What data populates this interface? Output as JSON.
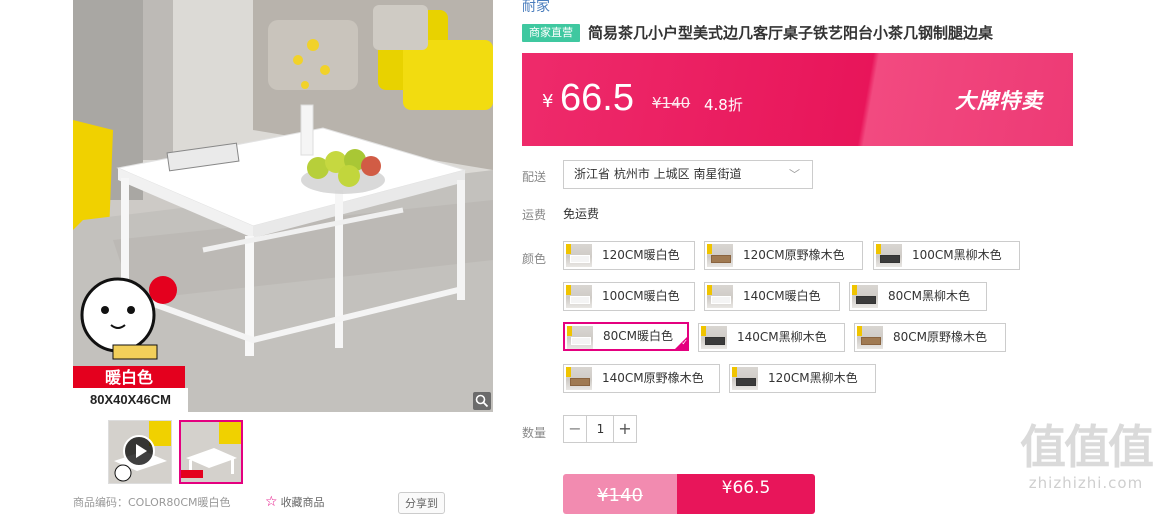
{
  "gallery": {
    "color_badge": "暖白色",
    "size_label": "80X40X46CM",
    "code_line": "商品编码：COLOR80CM暖白色",
    "favorite_label": "收藏商品",
    "share_label": "分享到"
  },
  "product": {
    "brand": "耐家",
    "tag": "商家直营",
    "title": "简易茶几小户型美式边几客厅桌子铁艺阳台小茶几钢制腿边桌"
  },
  "price": {
    "currency": "¥",
    "current": "66.5",
    "original": "¥140",
    "discount": "4.8折",
    "promo": "大牌特卖",
    "colors": {
      "banner": "#e8155a",
      "accent": "#e4007f",
      "tag": "#3fc8a0"
    }
  },
  "delivery": {
    "label": "配送",
    "address": "浙江省 杭州市 上城区 南星街道"
  },
  "shipping": {
    "label": "运费",
    "value": "免运费"
  },
  "color": {
    "label": "颜色",
    "options": [
      "120CM暖白色",
      "120CM原野橡木色",
      "100CM黑柳木色",
      "100CM暖白色",
      "140CM暖白色",
      "80CM黑柳木色",
      "80CM暖白色",
      "140CM黑柳木色",
      "80CM原野橡木色",
      "140CM原野橡木色",
      "120CM黑柳木色"
    ],
    "selected": "80CM暖白色"
  },
  "quantity": {
    "label": "数量",
    "value": "1",
    "minus": "−",
    "plus": "+"
  },
  "buy": {
    "original_price": "¥140",
    "sale_price": "¥66.5"
  },
  "watermark": {
    "big": "值值值",
    "small": "zhizhizhi.com"
  },
  "icons": [
    "zoom-icon",
    "play-icon",
    "star-icon",
    "chevron-down-icon",
    "check-icon"
  ]
}
